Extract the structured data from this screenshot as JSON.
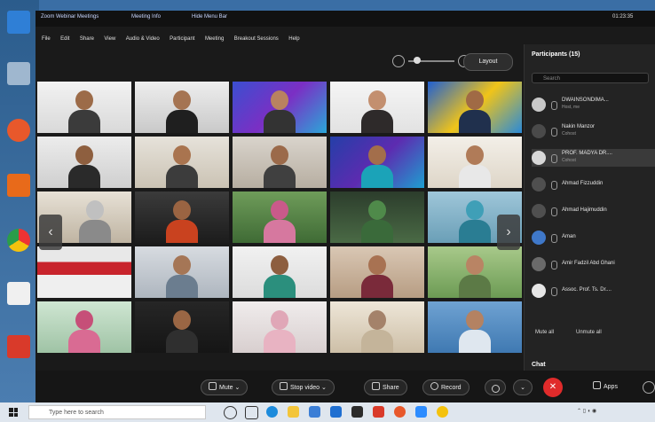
{
  "titlebar": {
    "app": "Zoom Webinar Meetings",
    "meeting_info": "Meeting Info",
    "view_menu": "Hide Menu Bar",
    "clock": "01:23:35"
  },
  "menubar": [
    "File",
    "Edit",
    "Share",
    "View",
    "Audio & Video",
    "Participant",
    "Meeting",
    "Breakout Sessions",
    "Help"
  ],
  "view_controls": {
    "layout_label": "Layout"
  },
  "icons": {
    "zoom_out": "zoom-out-icon",
    "zoom_in": "zoom-in-icon",
    "search": "search-icon",
    "mic": "microphone-icon",
    "camera": "video-camera-icon",
    "share": "share-screen-icon",
    "record": "record-icon",
    "reactions": "reactions-icon",
    "leave": "leave-icon",
    "apps": "apps-icon"
  },
  "participants_panel": {
    "title": "Participants (15)",
    "search_placeholder": "Search",
    "participants": [
      {
        "name": "DWAINSONDIMA...",
        "role": "Host, me"
      },
      {
        "name": "Nakin Manzor",
        "role": "Cohost"
      },
      {
        "name": "PROF. MADYA DR....",
        "role": "Cohost"
      },
      {
        "name": "Ahmad Fizzuddin",
        "role": ""
      },
      {
        "name": "Ahmad Hajimuddin",
        "role": ""
      },
      {
        "name": "Aman",
        "role": ""
      },
      {
        "name": "Amir Fadzil Abd Ghani",
        "role": ""
      },
      {
        "name": "Assoc. Prof. Ts. Dr....",
        "role": ""
      }
    ],
    "mute_all": "Mute all",
    "unmute_all": "Unmute all",
    "chat_label": "Chat"
  },
  "toolbar": {
    "mute": "Mute",
    "stop_video": "Stop video",
    "share": "Share",
    "record": "Record",
    "apps": "Apps"
  },
  "taskbar": {
    "search_placeholder": "Type here to search"
  },
  "grid": {
    "rows": 5,
    "columns": 5,
    "tile_count": 25
  },
  "colors": {
    "leave_red": "#e02b2b",
    "panel_bg": "#232323",
    "window_bg": "#1a1a1a"
  }
}
